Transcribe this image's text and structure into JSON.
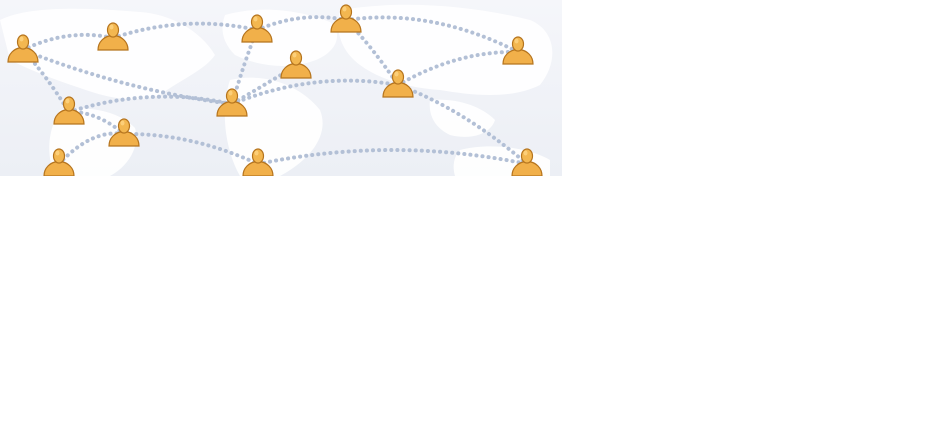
{
  "banner": {
    "icon": "person-network-map",
    "colors": {
      "background": "#eceff5",
      "land": "#ffffff",
      "link": "#b3c0d6",
      "person": "#f1b04a",
      "person_outline": "#b5741e"
    },
    "nodes": [
      {
        "id": "n1",
        "icon": "person-icon"
      },
      {
        "id": "n2",
        "icon": "person-icon"
      },
      {
        "id": "n3",
        "icon": "person-icon"
      },
      {
        "id": "n4",
        "icon": "person-icon"
      },
      {
        "id": "n5",
        "icon": "person-icon"
      },
      {
        "id": "n6",
        "icon": "person-icon"
      },
      {
        "id": "n7",
        "icon": "person-icon"
      },
      {
        "id": "n8",
        "icon": "person-icon"
      },
      {
        "id": "n9",
        "icon": "person-icon"
      },
      {
        "id": "n10",
        "icon": "person-icon"
      },
      {
        "id": "n11",
        "icon": "person-icon"
      },
      {
        "id": "n12",
        "icon": "person-icon"
      },
      {
        "id": "n13",
        "icon": "person-icon"
      }
    ]
  }
}
